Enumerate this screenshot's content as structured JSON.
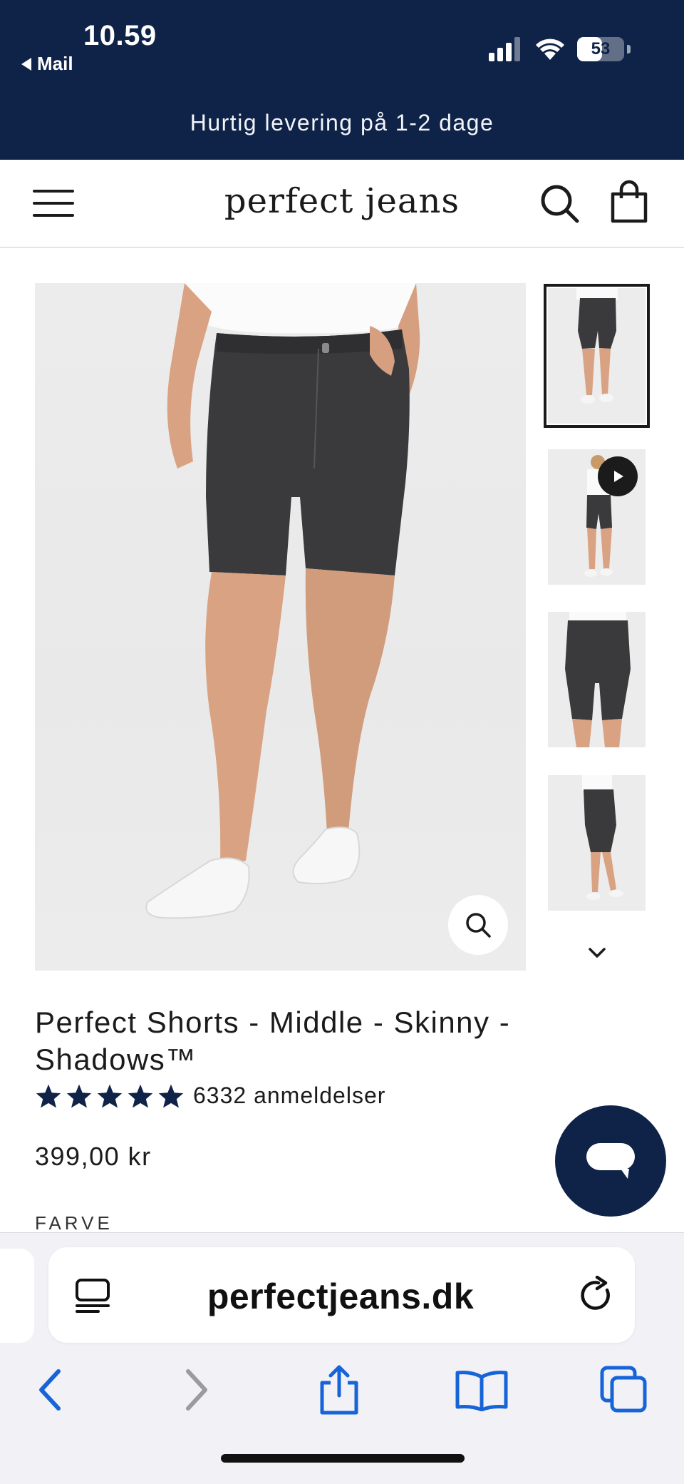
{
  "status_bar": {
    "time": "10.59",
    "back_label": "Mail",
    "battery_level": "53",
    "battery_percent": 53
  },
  "announcement": "Hurtig levering på 1-2 dage",
  "header": {
    "logo": "perfect jeans"
  },
  "gallery": {
    "thumbnail_count": 4,
    "active_thumbnail": 1,
    "video_thumbnail": 2
  },
  "product": {
    "title": "Perfect Shorts - Middle - Skinny - Shadows™",
    "rating_stars": 5,
    "review_count": "6332 anmeldelser",
    "price": "399,00 kr",
    "color_label": "FARVE"
  },
  "browser": {
    "url": "perfectjeans.dk"
  },
  "colors": {
    "brand_navy": "#0f2348",
    "safari_blue": "#1764d8",
    "safari_disabled": "#9a9aa0",
    "shorts_denim": "#3a3a3c"
  },
  "icons": {
    "menu": "hamburger-icon",
    "search": "search-icon",
    "bag": "shopping-bag-icon",
    "zoom": "zoom-icon",
    "play": "play-icon",
    "chevron": "chevron-down-icon",
    "chat": "chat-icon",
    "reader": "reader-mode-icon",
    "reload": "reload-icon",
    "back": "back-arrow-icon",
    "forward": "forward-arrow-icon",
    "share": "share-icon",
    "bookmarks": "bookmarks-icon",
    "tabs": "tabs-icon"
  }
}
